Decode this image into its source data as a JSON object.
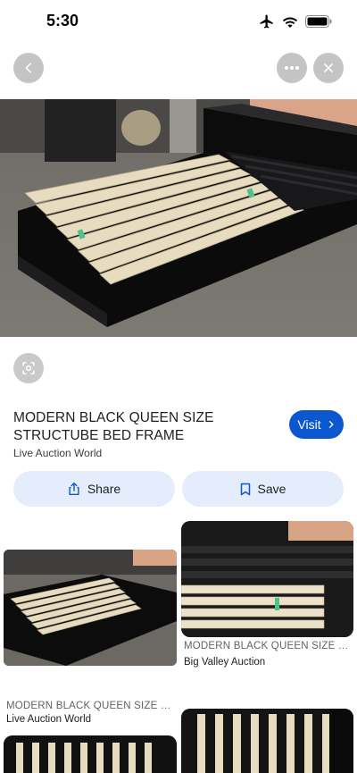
{
  "status": {
    "time": "5:30"
  },
  "nav": {
    "back_icon": "chevron-left-icon",
    "more_icon": "more-horizontal-icon",
    "close_icon": "close-icon"
  },
  "result": {
    "title": "MODERN BLACK QUEEN SIZE STRUCTUBE BED FRAME",
    "source": "Live Auction World",
    "visit_label": "Visit",
    "share_label": "Share",
    "save_label": "Save"
  },
  "related": [
    {
      "caption": "MODERN BLACK QUEEN SIZE ST...",
      "source": "Live Auction World"
    },
    {
      "caption": "MODERN BLACK QUEEN SIZE ST...",
      "source": "Big Valley Auction"
    }
  ],
  "colors": {
    "accent": "#0b57d0",
    "chip_bg": "#e5ecfb"
  }
}
